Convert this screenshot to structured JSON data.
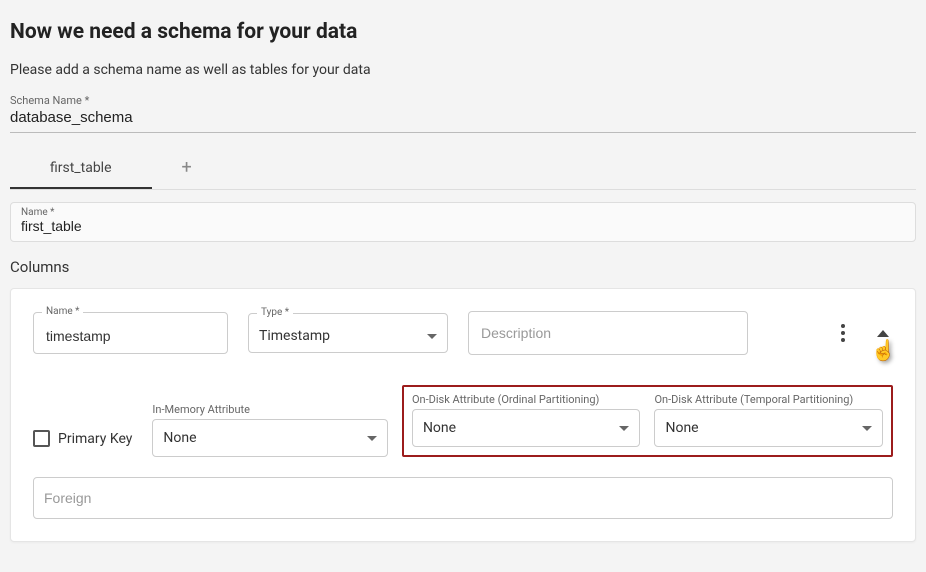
{
  "page": {
    "title": "Now we need a schema for your data",
    "subtitle": "Please add a schema name as well as tables for your data"
  },
  "schema": {
    "label": "Schema Name *",
    "value": "database_schema"
  },
  "tabs": {
    "active": "first_table",
    "add_icon": "plus-icon"
  },
  "table": {
    "name_label": "Name *",
    "name_value": "first_table"
  },
  "columns": {
    "heading": "Columns",
    "col": {
      "name_label": "Name *",
      "name_value": "timestamp",
      "type_label": "Type *",
      "type_value": "Timestamp",
      "desc_placeholder": "Description",
      "pk_label": "Primary Key",
      "inmem_label": "In-Memory Attribute",
      "inmem_value": "None",
      "ondisk_ord_label": "On-Disk Attribute (Ordinal Partitioning)",
      "ondisk_ord_value": "None",
      "ondisk_temp_label": "On-Disk Attribute (Temporal Partitioning)",
      "ondisk_temp_value": "None",
      "foreign_placeholder": "Foreign"
    }
  }
}
